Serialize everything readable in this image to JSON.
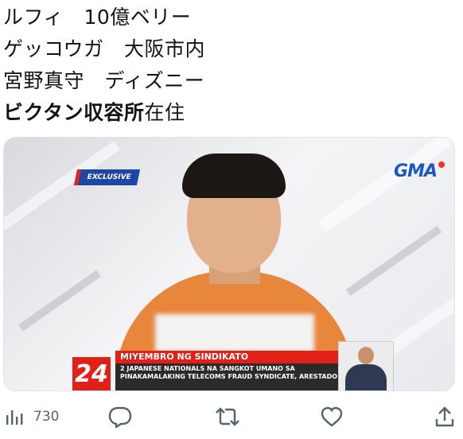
{
  "tweet": {
    "lines": [
      {
        "text": "ルフィ　10億ベリー"
      },
      {
        "text": "ゲッコウガ　大阪市内"
      },
      {
        "text": "宮野真守　ディズニー"
      },
      {
        "bold": "ビクタン収容所",
        "rest": "在住"
      }
    ]
  },
  "media": {
    "exclusive_label": "EXCLUSIVE",
    "logo_text": "GMA",
    "channel_number": "24",
    "headline_label": "MIYEMBRO NG SINDIKATO",
    "headline_body": "2 JAPANESE NATIONALS NA SANGKOT UMANO SA PINAKAMALAKING TELECOMS FRAUD SYNDICATE, ARESTADO"
  },
  "actions": {
    "views_count": "730"
  },
  "colors": {
    "icon": "#536471",
    "news_red": "#e32018",
    "news_blue": "#1d46a8",
    "shirt_orange": "#e8863c"
  }
}
